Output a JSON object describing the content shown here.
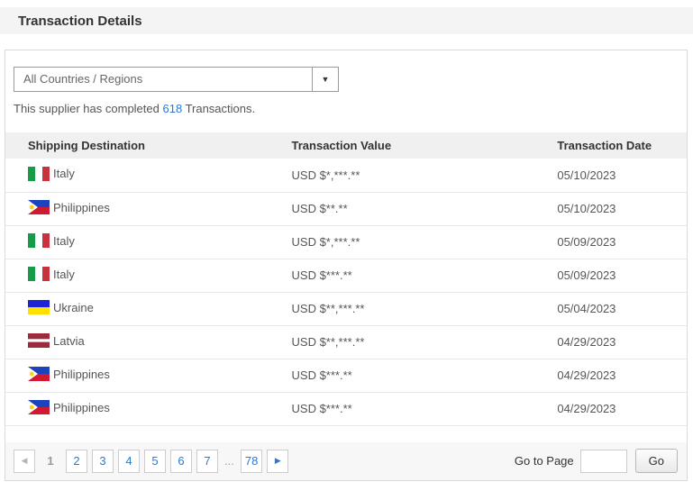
{
  "page": {
    "title": "Transaction Details"
  },
  "filter": {
    "selected_option": "All Countries / Regions",
    "chevron_icon": "▼"
  },
  "summary": {
    "prefix": "This supplier has completed ",
    "count": "618",
    "suffix": " Transactions."
  },
  "table": {
    "columns": [
      "Shipping Destination",
      "Transaction Value",
      "Transaction Date"
    ],
    "rows": [
      {
        "country": "Italy",
        "flag": "it",
        "value": "USD $*,***.**",
        "date": "05/10/2023"
      },
      {
        "country": "Philippines",
        "flag": "ph",
        "value": "USD $**.**",
        "date": "05/10/2023"
      },
      {
        "country": "Italy",
        "flag": "it",
        "value": "USD $*,***.**",
        "date": "05/09/2023"
      },
      {
        "country": "Italy",
        "flag": "it",
        "value": "USD $***.**",
        "date": "05/09/2023"
      },
      {
        "country": "Ukraine",
        "flag": "ua",
        "value": "USD $**,***.**",
        "date": "05/04/2023"
      },
      {
        "country": "Latvia",
        "flag": "lv",
        "value": "USD $**,***.**",
        "date": "04/29/2023"
      },
      {
        "country": "Philippines",
        "flag": "ph",
        "value": "USD $***.**",
        "date": "04/29/2023"
      },
      {
        "country": "Philippines",
        "flag": "ph",
        "value": "USD $***.**",
        "date": "04/29/2023"
      }
    ]
  },
  "pagination": {
    "prev_icon": "◀",
    "next_icon": "▶",
    "current_page": "1",
    "pages": [
      "2",
      "3",
      "4",
      "5",
      "6",
      "7"
    ],
    "ellipsis": "...",
    "last_page": "78",
    "goto_label": "Go to Page",
    "goto_value": "",
    "go_button": "Go"
  },
  "flags": {
    "it": {
      "type": "vertical",
      "colors": [
        "#169b48",
        "#ffffff",
        "#c8313e"
      ]
    },
    "ph": {
      "type": "philippines",
      "blue": "#1a43bd",
      "red": "#d01932",
      "white": "#ffffff",
      "sun": "#fdd116"
    },
    "ua": {
      "type": "horizontal",
      "colors": [
        "#1c24d6",
        "#ffe000"
      ],
      "ratios": [
        0.5,
        0.5
      ]
    },
    "lv": {
      "type": "horizontal",
      "colors": [
        "#9c2b3d",
        "#ffffff",
        "#9c2b3d"
      ],
      "ratios": [
        0.4,
        0.2,
        0.4
      ]
    }
  },
  "colors": {
    "link_blue": "#2979d9",
    "disabled_gray": "#b5b5b5",
    "panel_border": "#d9d9d9",
    "header_bg": "#f0f0f0"
  }
}
